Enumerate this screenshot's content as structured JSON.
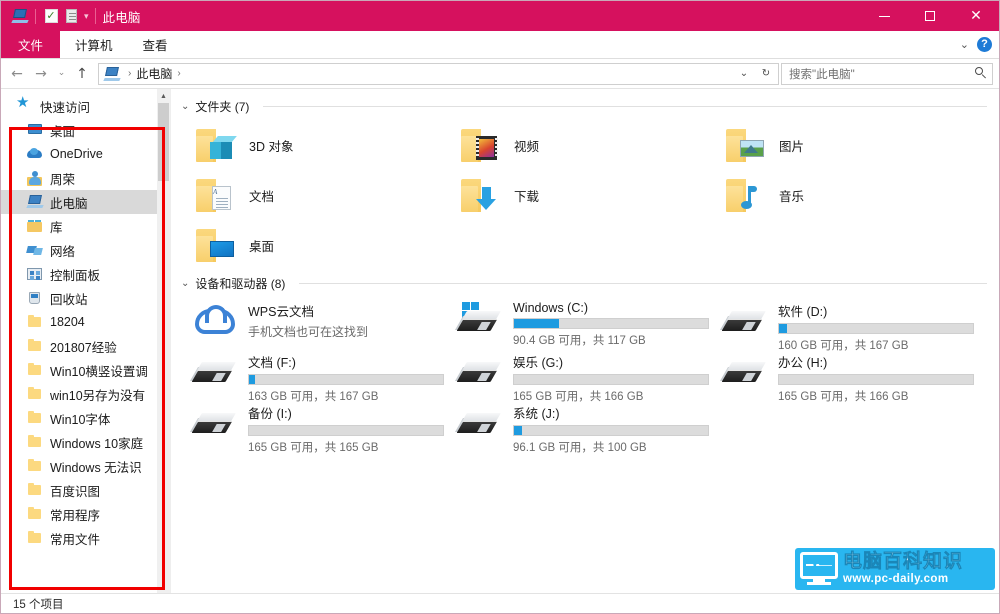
{
  "window": {
    "title": "此电脑",
    "accent_color": "#d6115e",
    "quick_access_icons": [
      "this-pc-icon",
      "properties-checkbox-icon",
      "properties-icon",
      "customize-caret-icon"
    ],
    "controls": {
      "minimize": "—",
      "maximize": "□",
      "close": "✕"
    }
  },
  "ribbon": {
    "file_tab": "文件",
    "tabs": [
      "计算机",
      "查看"
    ],
    "collapse_label": "⌄",
    "help_label": "?"
  },
  "address": {
    "back": "←",
    "forward": "→",
    "recent": "⌄",
    "up": "↑",
    "crumb_icon": "this-pc-icon",
    "crumbs": [
      "此电脑"
    ],
    "crumb_sep": "›",
    "dropdown": "⌄",
    "refresh": "↻",
    "search_placeholder": "搜索\"此电脑\""
  },
  "sidebar": {
    "items": [
      {
        "label": "快速访问",
        "icon": "star-icon",
        "indent": 0,
        "selected": false
      },
      {
        "label": "桌面",
        "icon": "desktop-icon",
        "indent": 1,
        "selected": false
      },
      {
        "label": "OneDrive",
        "icon": "onedrive-icon",
        "indent": 1,
        "selected": false
      },
      {
        "label": "周荣",
        "icon": "user-folder-icon",
        "indent": 1,
        "selected": false
      },
      {
        "label": "此电脑",
        "icon": "this-pc-icon",
        "indent": 1,
        "selected": true
      },
      {
        "label": "库",
        "icon": "library-icon",
        "indent": 1,
        "selected": false
      },
      {
        "label": "网络",
        "icon": "network-icon",
        "indent": 1,
        "selected": false
      },
      {
        "label": "控制面板",
        "icon": "control-panel-icon",
        "indent": 1,
        "selected": false
      },
      {
        "label": "回收站",
        "icon": "recycle-bin-icon",
        "indent": 1,
        "selected": false
      },
      {
        "label": "18204",
        "icon": "folder-icon",
        "indent": 1,
        "selected": false
      },
      {
        "label": "201807经验",
        "icon": "folder-icon",
        "indent": 1,
        "selected": false
      },
      {
        "label": "Win10横竖设置调",
        "icon": "folder-icon",
        "indent": 1,
        "selected": false
      },
      {
        "label": "win10另存为没有",
        "icon": "folder-icon",
        "indent": 1,
        "selected": false
      },
      {
        "label": "Win10字体",
        "icon": "folder-icon",
        "indent": 1,
        "selected": false
      },
      {
        "label": "Windows 10家庭",
        "icon": "folder-icon",
        "indent": 1,
        "selected": false
      },
      {
        "label": "Windows 无法识",
        "icon": "folder-icon",
        "indent": 1,
        "selected": false
      },
      {
        "label": "百度识图",
        "icon": "folder-icon",
        "indent": 1,
        "selected": false
      },
      {
        "label": "常用程序",
        "icon": "folder-icon",
        "indent": 1,
        "selected": false
      },
      {
        "label": "常用文件",
        "icon": "folder-icon",
        "indent": 1,
        "selected": false
      }
    ],
    "highlight_color": "#f10000"
  },
  "content": {
    "folders_group": {
      "label": "文件夹 (7)",
      "chevron": "⌄"
    },
    "folders": [
      {
        "label": "3D 对象",
        "icon": "folder-3d-objects-icon"
      },
      {
        "label": "视频",
        "icon": "folder-videos-icon"
      },
      {
        "label": "图片",
        "icon": "folder-pictures-icon"
      },
      {
        "label": "文档",
        "icon": "folder-documents-icon"
      },
      {
        "label": "下载",
        "icon": "folder-downloads-icon"
      },
      {
        "label": "音乐",
        "icon": "folder-music-icon"
      },
      {
        "label": "桌面",
        "icon": "folder-desktop-icon"
      }
    ],
    "drives_group": {
      "label": "设备和驱动器 (8)",
      "chevron": "⌄"
    },
    "drives": [
      {
        "name": "WPS云文档",
        "sub": "手机文档也可在这找到",
        "icon": "cloud-icon",
        "has_bar": false,
        "fill_pct": 0
      },
      {
        "name": "Windows (C:)",
        "sub": "90.4 GB 可用，共 117 GB",
        "icon": "windows-drive-icon",
        "has_bar": true,
        "fill_pct": 23
      },
      {
        "name": "软件 (D:)",
        "sub": "160 GB 可用，共 167 GB",
        "icon": "drive-icon",
        "has_bar": true,
        "fill_pct": 4
      },
      {
        "name": "文档 (F:)",
        "sub": "163 GB 可用，共 167 GB",
        "icon": "drive-icon",
        "has_bar": true,
        "fill_pct": 3
      },
      {
        "name": "娱乐 (G:)",
        "sub": "165 GB 可用，共 166 GB",
        "icon": "drive-icon",
        "has_bar": true,
        "fill_pct": 0
      },
      {
        "name": "办公 (H:)",
        "sub": "165 GB 可用，共 166 GB",
        "icon": "drive-icon",
        "has_bar": true,
        "fill_pct": 0
      },
      {
        "name": "备份 (I:)",
        "sub": "165 GB 可用，共 165 GB",
        "icon": "drive-icon",
        "has_bar": true,
        "fill_pct": 0
      },
      {
        "name": "系统 (J:)",
        "sub": "96.1 GB 可用，共 100 GB",
        "icon": "drive-icon",
        "has_bar": true,
        "fill_pct": 4
      }
    ]
  },
  "status": {
    "item_count": "15 个项目"
  },
  "watermark": {
    "cn": "电脑百科知识",
    "url": "www.pc-daily.com",
    "color": "#29b6f0"
  }
}
